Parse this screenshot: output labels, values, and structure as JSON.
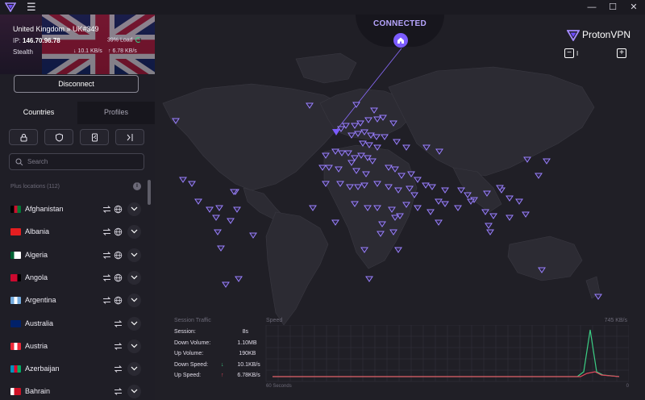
{
  "titlebar": {
    "menu_glyph": "☰",
    "minimize": "—",
    "maximize": "☐",
    "close": "✕"
  },
  "connection": {
    "country_server": "United Kingdom » UK#349",
    "ip_label": "IP:",
    "ip": "146.70.96.78",
    "load": "39% Load",
    "protocol": "Stealth",
    "down": "↓ 10.1 KB/s",
    "up": "↑ 6.78 KB/s",
    "disconnect_label": "Disconnect"
  },
  "tabs": {
    "countries": "Countries",
    "profiles": "Profiles"
  },
  "search": {
    "placeholder": "Search"
  },
  "list_header": "Plus locations (112)",
  "countries": [
    {
      "name": "Afghanistan",
      "flag": [
        "#000000",
        "#c8102e",
        "#007a36"
      ],
      "swap": true
    },
    {
      "name": "Albania",
      "flag": [
        "#e41e20",
        "#e41e20",
        "#e41e20"
      ],
      "swap": true
    },
    {
      "name": "Algeria",
      "flag": [
        "#006233",
        "#ffffff",
        "#ffffff"
      ],
      "swap": true
    },
    {
      "name": "Angola",
      "flag": [
        "#cc092f",
        "#cc092f",
        "#000000"
      ],
      "swap": true
    },
    {
      "name": "Argentina",
      "flag": [
        "#74acdf",
        "#ffffff",
        "#74acdf"
      ],
      "swap": true
    },
    {
      "name": "Australia",
      "flag": [
        "#012169",
        "#012169",
        "#012169"
      ],
      "swap": false
    },
    {
      "name": "Austria",
      "flag": [
        "#ed2939",
        "#ffffff",
        "#ed2939"
      ],
      "swap": false
    },
    {
      "name": "Azerbaijan",
      "flag": [
        "#0092bc",
        "#e4002b",
        "#00af66"
      ],
      "swap": false
    },
    {
      "name": "Bahrain",
      "flag": [
        "#ffffff",
        "#ce1126",
        "#ce1126"
      ],
      "swap": false
    }
  ],
  "map": {
    "status": "CONNECTED",
    "brand": "ProtonVPN",
    "zoom_minus": "−",
    "zoom_value": "I",
    "zoom_plus": "+",
    "accent": "#7c5cff"
  },
  "session": {
    "title": "Session Traffic",
    "rows": [
      {
        "label": "Session:",
        "value": "8s",
        "unit": ""
      },
      {
        "label": "Down Volume:",
        "value": "1.10",
        "unit": "MB"
      },
      {
        "label": "Up Volume:",
        "value": "190",
        "unit": "KB"
      },
      {
        "label": "Down Speed:",
        "value": "10.1",
        "unit": "KB/s",
        "arrow": "↓"
      },
      {
        "label": "Up Speed:",
        "value": "6.78",
        "unit": "KB/s",
        "arrow": "↑"
      }
    ]
  },
  "speed": {
    "title": "Speed",
    "max": "745 KB/s",
    "footer_left": "60 Seconds",
    "footer_right": "0",
    "down_color": "#3bcf85",
    "up_color": "#e0485c"
  }
}
